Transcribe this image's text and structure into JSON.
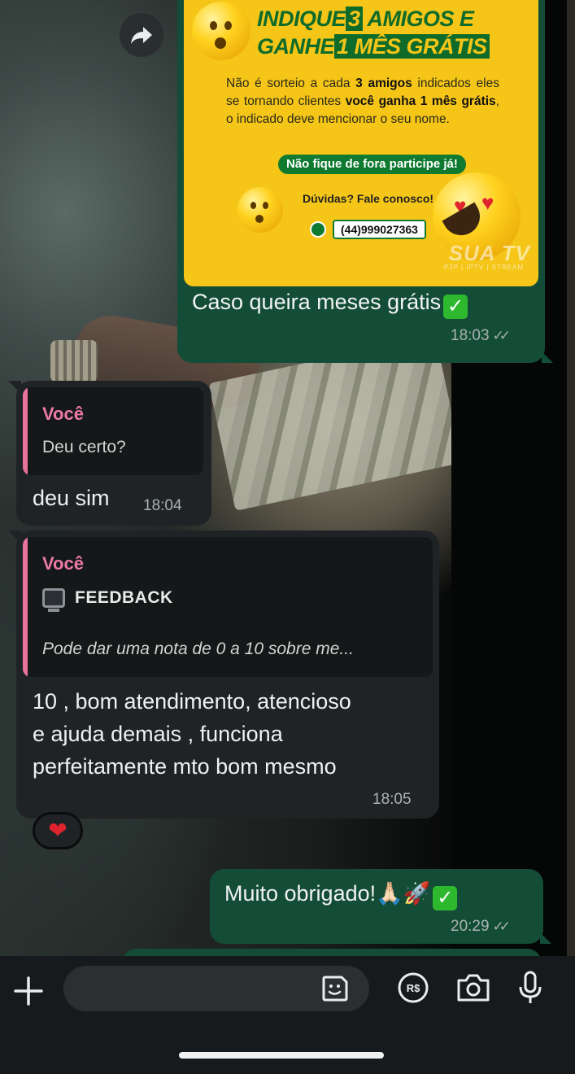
{
  "promo": {
    "title_line1_a": "INDIQUE",
    "title_line1_num": "3",
    "title_line1_b": "AMIGOS E",
    "title_line2_a": "GANHE",
    "title_line2_hl": "1 MÊS GRÁTIS",
    "body_1": "Não é sorteio a cada ",
    "body_bold1": "3 amigos",
    "body_2": " indicados eles se tornando clientes ",
    "body_bold2": "você ganha 1 mês grátis",
    "body_3": ", o indicado deve mencionar o seu nome.",
    "pill": "Não fique de fora participe já!",
    "duvidas": "Dúvidas? Fale conosco!",
    "phone": "(44)999027363",
    "brand": "SUA TV",
    "brand_sub": "P2P | IPTV | STREAM"
  },
  "messages": {
    "out1": {
      "caption": "Caso queira meses grátis",
      "time": "18:03"
    },
    "in1": {
      "quote_name": "Você",
      "quote_text": "Deu certo?",
      "text": "deu sim",
      "time": "18:04"
    },
    "in2": {
      "quote_name": "Você",
      "quote_title": "FEEDBACK",
      "quote_text": "Pode dar uma nota de 0 a 10 sobre me...",
      "line1": "10 , bom atendimento, atencioso",
      "line2": "e ajuda demais , funciona",
      "line3": "perfeitamente mto bom mesmo",
      "time": "18:05",
      "reaction": "❤"
    },
    "out2": {
      "text": "Muito obrigado!",
      "emojis": "🙏🏻🚀",
      "time": "20:29"
    }
  },
  "composer": {
    "plus_icon": "plus-icon",
    "sticker_icon": "sticker-icon",
    "payment_icon": "payment-icon",
    "payment_label": "R$",
    "camera_icon": "camera-icon",
    "mic_icon": "microphone-icon"
  },
  "colors": {
    "outgoing_bubble": "#144d37",
    "incoming_bubble": "#1f2326",
    "quote_accent": "#e7739b",
    "promo_yellow": "#f5c518",
    "promo_green": "#0f6b2a"
  }
}
